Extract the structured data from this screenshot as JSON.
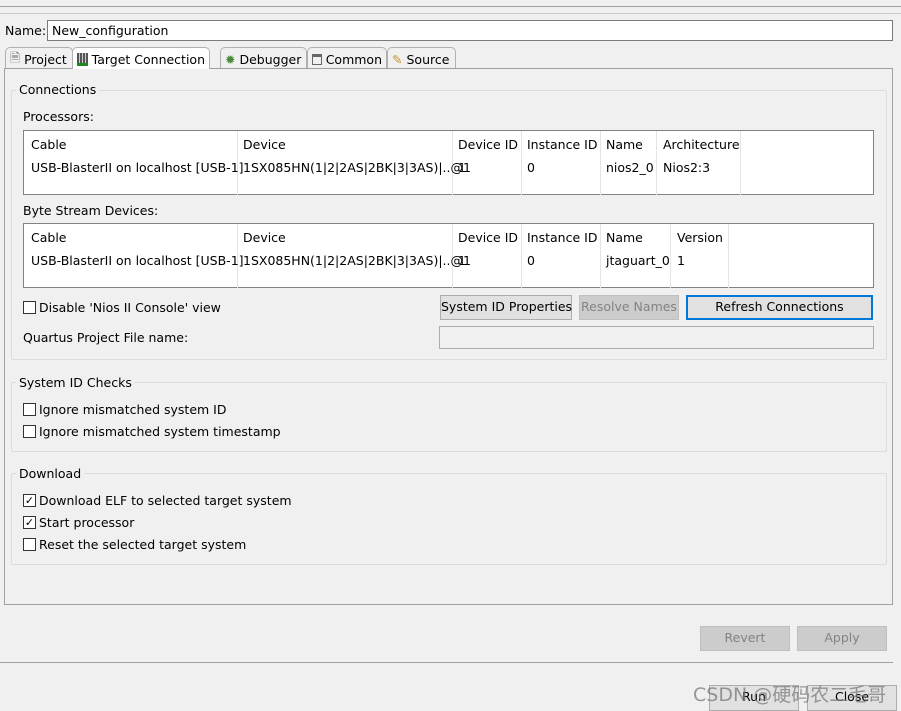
{
  "name_label": "Name:",
  "name_value": "New_configuration",
  "tabs": [
    {
      "label": "Project",
      "icon": "document-icon"
    },
    {
      "label": "Target Connection",
      "icon": "connector-icon"
    },
    {
      "label": "Debugger",
      "icon": "bug-icon"
    },
    {
      "label": "Common",
      "icon": "table-icon"
    },
    {
      "label": "Source",
      "icon": "source-icon"
    }
  ],
  "active_tab": "Target Connection",
  "connections": {
    "title": "Connections",
    "processors_label": "Processors:",
    "processors": {
      "columns": [
        "Cable",
        "Device",
        "Device ID",
        "Instance ID",
        "Name",
        "Architecture"
      ],
      "rows": [
        [
          "USB-BlasterII on localhost [USB-1]",
          "1SX085HN(1|2|2AS|2BK|3|3AS)|..@1",
          "1",
          "0",
          "nios2_0",
          "Nios2:3"
        ]
      ]
    },
    "byte_label": "Byte Stream Devices:",
    "byte": {
      "columns": [
        "Cable",
        "Device",
        "Device ID",
        "Instance ID",
        "Name",
        "Version"
      ],
      "rows": [
        [
          "USB-BlasterII on localhost [USB-1]",
          "1SX085HN(1|2|2AS|2BK|3|3AS)|..@1",
          "1",
          "0",
          "jtaguart_0",
          "1"
        ]
      ]
    },
    "disable_console": {
      "label": "Disable 'Nios II Console' view",
      "checked": false
    },
    "sysid_button": "System ID Properties",
    "resolve_button": "Resolve Names",
    "refresh_button": "Refresh Connections",
    "quartus_label": "Quartus Project File name:",
    "quartus_value": ""
  },
  "sysid": {
    "title": "System ID Checks",
    "items": [
      {
        "label": "Ignore mismatched system ID",
        "checked": false
      },
      {
        "label": "Ignore mismatched system timestamp",
        "checked": false
      }
    ]
  },
  "download": {
    "title": "Download",
    "items": [
      {
        "label": "Download ELF to selected target system",
        "checked": true
      },
      {
        "label": "Start processor",
        "checked": true
      },
      {
        "label": "Reset the selected target system",
        "checked": false
      }
    ]
  },
  "revert": "Revert",
  "apply": "Apply",
  "run": "Run",
  "close": "Close",
  "watermark": "CSDN @硬码农二毛哥",
  "colors": {
    "focus": "#0078d7",
    "disabled": "#cccccc"
  }
}
